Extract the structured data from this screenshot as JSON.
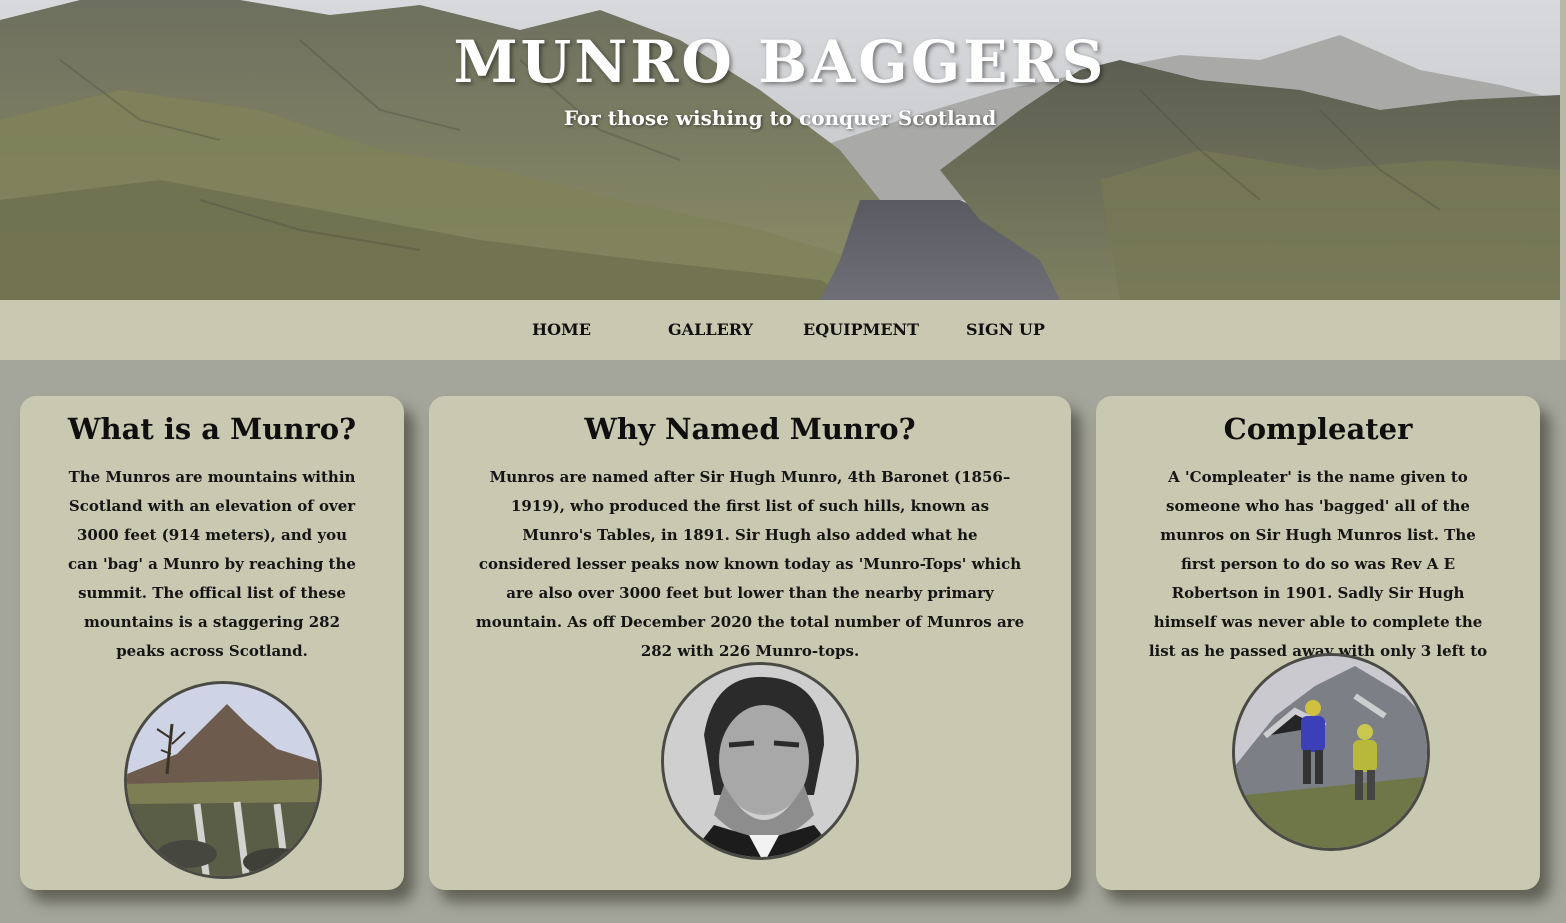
{
  "header": {
    "title": "MUNRO BAGGERS",
    "subtitle": "For those wishing to conquer Scotland"
  },
  "nav": {
    "items": [
      {
        "label": "HOME"
      },
      {
        "label": "GALLERY"
      },
      {
        "label": "EQUIPMENT"
      },
      {
        "label": "SIGN UP"
      }
    ]
  },
  "cards": [
    {
      "title": "What is a Munro?",
      "text": "The Munros are mountains within Scotland with an elevation of over 3000 feet (914 meters), and you can 'bag' a Munro by reaching the summit. The offical list of these mountains is a staggering 282 peaks across Scotland.",
      "image_icon": "mountain-waterfall-photo"
    },
    {
      "title": "Why Named Munro?",
      "text": "Munros are named after Sir Hugh Munro, 4th Baronet (1856–1919), who produced the first list of such hills, known as Munro's Tables, in 1891. Sir Hugh also added what he considered lesser peaks now known today as 'Munro-Tops' which are also over 3000 feet but lower than the nearby primary mountain. As off December 2020 the total number of Munros are 282 with 226 Munro-tops.",
      "image_icon": "portrait-photo"
    },
    {
      "title": "Compleater",
      "text": "A 'Compleater' is the name given to someone who has 'bagged' all of the munros on Sir Hugh Munros list. The first person to do so was Rev A E Robertson in 1901. Sadly Sir Hugh himself was never able to complete the list as he passed away with only 3 left to go.",
      "image_icon": "hikers-photo"
    }
  ],
  "colors": {
    "page_background": "#a5a69b",
    "nav_background": "#c8c9b0",
    "card_background": "#c8c9b0",
    "text": "#111111"
  }
}
